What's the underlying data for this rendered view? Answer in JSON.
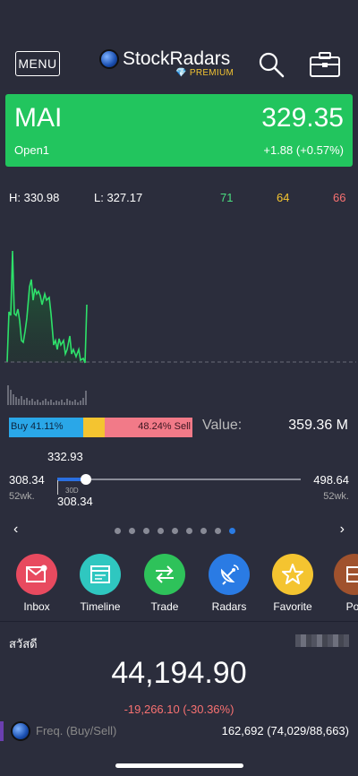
{
  "header": {
    "menu_label": "MENU",
    "brand": "StockRadars",
    "tier": "PREMIUM"
  },
  "quote": {
    "symbol": "MAI",
    "price": "329.35",
    "session": "Open1",
    "change": "+1.88 (+0.57%)"
  },
  "stats": {
    "high": "H: 330.98",
    "low": "L: 327.17",
    "n1": "71",
    "n2": "64",
    "n3": "66"
  },
  "buysell": {
    "buy_label": "Buy 41.11%",
    "sell_label": "48.24% Sell",
    "buy_pct": 41.11,
    "sell_pct": 48.24,
    "value_label": "Value:",
    "value": "359.36 M"
  },
  "range": {
    "low": "308.34",
    "high": "498.64",
    "low_label": "52wk.",
    "high_label": "52wk.",
    "current": "332.93",
    "thirty_label": "30D",
    "thirty_value": "308.34"
  },
  "pager": {
    "left": "‹",
    "right": "›",
    "pages": 9,
    "active_index": 8
  },
  "apps": [
    {
      "label": "Inbox",
      "color": "#e84a5f",
      "icon": "mail-icon"
    },
    {
      "label": "Timeline",
      "color": "#2fc7c0",
      "icon": "window-icon"
    },
    {
      "label": "Trade",
      "color": "#2ec25a",
      "icon": "swap-icon"
    },
    {
      "label": "Radars",
      "color": "#2a7be4",
      "icon": "satellite-icon"
    },
    {
      "label": "Favorite",
      "color": "#f4c430",
      "icon": "star-icon"
    },
    {
      "label": "Por",
      "color": "#a0522d",
      "icon": "portfolio-icon"
    }
  ],
  "market": {
    "greeting": "สวัสดี",
    "index": "44,194.90",
    "change": "-19,266.10 (-30.36%)",
    "freq_label": "Freq. (Buy/Sell)",
    "freq_value": "162,692 (74,029/88,663)"
  },
  "colors": {
    "background": "#2b2d3c",
    "green": "#22c55e",
    "red": "#f87171",
    "yellow": "#f4c430",
    "blue": "#2a7be4"
  }
}
